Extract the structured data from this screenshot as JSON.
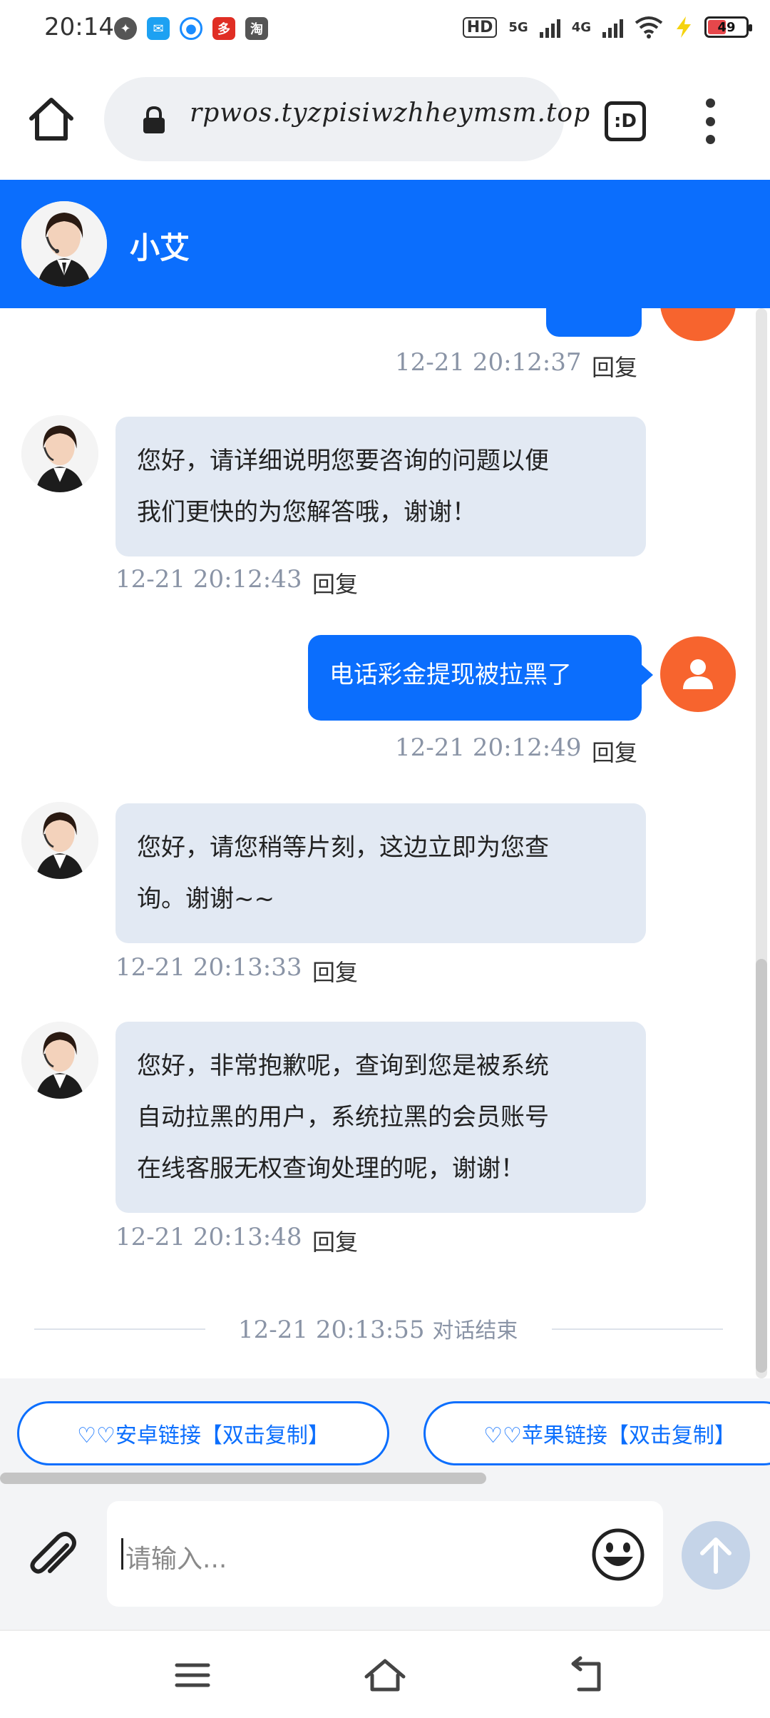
{
  "status_bar": {
    "time": "20:14",
    "app_icons": [
      "weibo-icon",
      "message-app-icon",
      "qq-icon",
      "pinduoduo-icon",
      "taobao-icon"
    ],
    "network_hd": "HD",
    "network_5g": "5G",
    "network_4g": "4G",
    "battery": "49"
  },
  "browser": {
    "url": "rpwos.tyzpisiwzhheymsm.top",
    "tab_label": ":D"
  },
  "chat_header": {
    "agent_name": "小艾"
  },
  "messages": [
    {
      "type": "timestamp",
      "time": "12-21 20:12:37",
      "reply": "回复"
    },
    {
      "type": "agent",
      "lines": [
        "您好，请详细说明您要咨询的问题以便",
        "我们更快的为您解答哦，谢谢！"
      ],
      "time": "12-21 20:12:43",
      "reply": "回复"
    },
    {
      "type": "user",
      "text": "电话彩金提现被拉黑了",
      "time": "12-21 20:12:49",
      "reply": "回复"
    },
    {
      "type": "agent",
      "lines": [
        "您好，请您稍等片刻，这边立即为您查",
        "询。谢谢~~"
      ],
      "time": "12-21 20:13:33",
      "reply": "回复"
    },
    {
      "type": "agent",
      "lines": [
        "您好，非常抱歉呢，查询到您是被系统",
        "自动拉黑的用户，系统拉黑的会员账号",
        "在线客服无权查询处理的呢，谢谢！"
      ],
      "time": "12-21 20:13:48",
      "reply": "回复"
    }
  ],
  "chat_end": {
    "time": "12-21 20:13:55",
    "label": "对话结束"
  },
  "quick_links": [
    {
      "label": "♡♡安卓链接【双击复制】"
    },
    {
      "label": "♡♡苹果链接【双击复制】"
    }
  ],
  "input": {
    "placeholder": "请输入..."
  },
  "colors": {
    "brand_blue": "#0b6efd",
    "agent_bubble": "#e2e9f3",
    "user_avatar": "#f7642e",
    "timestamp": "#8a94a6"
  },
  "nav_icons": [
    "menu-icon",
    "home-icon",
    "back-icon"
  ]
}
